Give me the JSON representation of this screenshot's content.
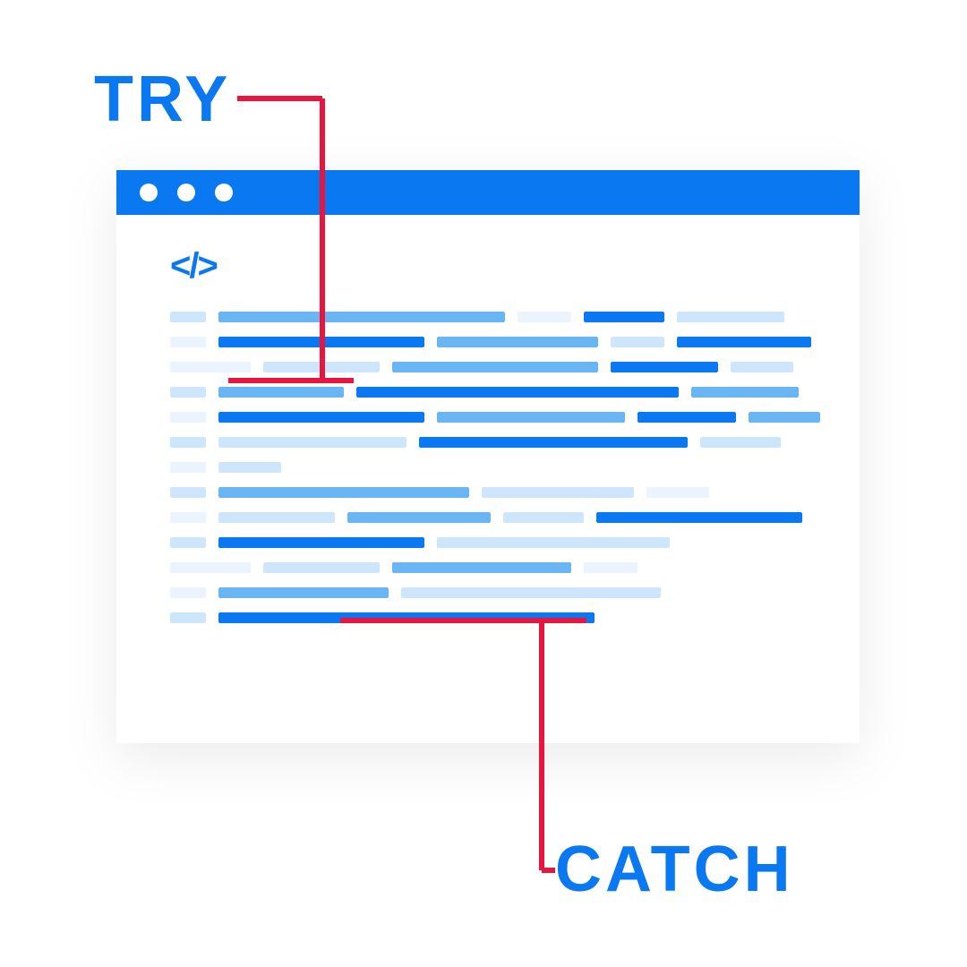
{
  "labels": {
    "try": "TRY",
    "catch": "CATCH",
    "code_icon": "</>"
  },
  "colors": {
    "blue": "#0a78f0",
    "red": "#e8163e"
  }
}
